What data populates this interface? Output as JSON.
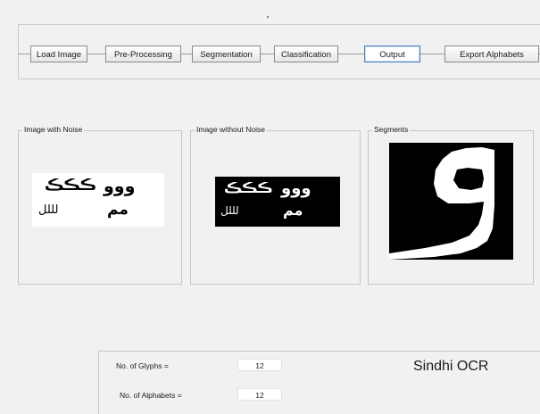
{
  "toolbar": {
    "buttons": [
      {
        "label": "Load Image"
      },
      {
        "label": "Pre-Processing"
      },
      {
        "label": "Segmentation"
      },
      {
        "label": "Classification"
      },
      {
        "label": "Output"
      },
      {
        "label": "Export Alphabets"
      }
    ]
  },
  "panels": {
    "noisy": {
      "title": "Image with Noise"
    },
    "clean": {
      "title": "Image without Noise"
    },
    "segments": {
      "title": "Segments"
    }
  },
  "glyphs": {
    "row1_left": "ڪڪڪ",
    "row1_right": "ووو",
    "row2_left": "لللل",
    "row2_right": "مم"
  },
  "info": {
    "glyphs_label": "No. of Glyphs =",
    "glyphs_value": "12",
    "alphabets_label": "No. of Alphabets =",
    "alphabets_value": "12",
    "app_title": "Sindhi OCR"
  },
  "colors": {
    "active_border": "#4a7ebb",
    "image_dark": "#000000",
    "image_light": "#ffffff"
  }
}
